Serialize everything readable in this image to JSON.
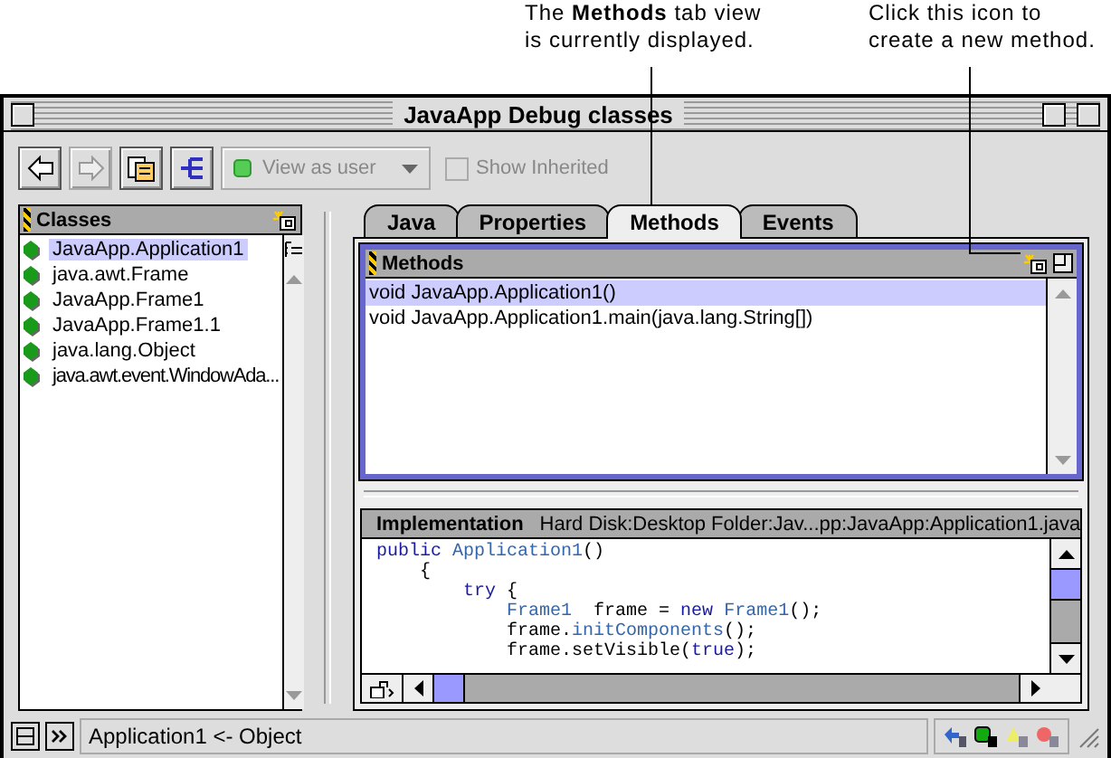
{
  "callouts": [
    {
      "text": "The **Methods** tab view\nis currently displayed."
    },
    {
      "text": "Click this icon to\ncreate a new method."
    }
  ],
  "window": {
    "title": "JavaApp Debug classes"
  },
  "toolbar": {
    "buttons": [
      {
        "kind": "back",
        "disabled": false
      },
      {
        "kind": "forward",
        "disabled": true
      },
      {
        "kind": "browse",
        "disabled": false
      },
      {
        "kind": "hierarchy",
        "disabled": false
      }
    ],
    "view_menu": {
      "value": "View as user",
      "disabled": true
    },
    "show_inherited": {
      "label": "Show Inherited",
      "checked": false,
      "disabled": true
    }
  },
  "classes_pane": {
    "title": "Classes",
    "items": [
      {
        "label": "JavaApp.Application1",
        "selected": true
      },
      {
        "label": "java.awt.Frame",
        "selected": false
      },
      {
        "label": "JavaApp.Frame1",
        "selected": false
      },
      {
        "label": "JavaApp.Frame1.1",
        "selected": false
      },
      {
        "label": "java.lang.Object",
        "selected": false
      },
      {
        "label": "java.awt.event.WindowAda...",
        "selected": false
      }
    ]
  },
  "tabs": [
    {
      "label": "Java",
      "selected": false
    },
    {
      "label": "Properties",
      "selected": false
    },
    {
      "label": "Methods",
      "selected": true
    },
    {
      "label": "Events",
      "selected": false
    }
  ],
  "methods_pane": {
    "title": "Methods",
    "items": [
      {
        "label": "void JavaApp.Application1()",
        "selected": true
      },
      {
        "label": "void JavaApp.Application1.main(java.lang.String[])",
        "selected": false
      }
    ]
  },
  "implementation_pane": {
    "title": "Implementation",
    "path": "Hard Disk:Desktop Folder:Jav...pp:JavaApp:Application1.java",
    "code": [
      [
        {
          "kind": "keyword",
          "text": "public"
        },
        {
          "kind": "name",
          "text": " Application1"
        },
        {
          "kind": "plain",
          "text": "()"
        }
      ],
      [
        {
          "kind": "plain",
          "text": "    {"
        }
      ],
      [
        {
          "kind": "keyword",
          "text": "        try"
        },
        {
          "kind": "plain",
          "text": " {"
        }
      ],
      [
        {
          "kind": "name",
          "text": "            Frame1"
        },
        {
          "kind": "plain",
          "text": "  frame = "
        },
        {
          "kind": "keyword",
          "text": "new"
        },
        {
          "kind": "name",
          "text": " Frame1"
        },
        {
          "kind": "plain",
          "text": "();"
        }
      ],
      [
        {
          "kind": "plain",
          "text": "            frame."
        },
        {
          "kind": "name",
          "text": "initComponents"
        },
        {
          "kind": "plain",
          "text": "();"
        }
      ],
      [
        {
          "kind": "plain",
          "text": "            frame.setVisible("
        },
        {
          "kind": "keyword",
          "text": "true"
        },
        {
          "kind": "plain",
          "text": ");"
        }
      ]
    ]
  },
  "status_bar": {
    "text": "Application1 <- Object"
  }
}
